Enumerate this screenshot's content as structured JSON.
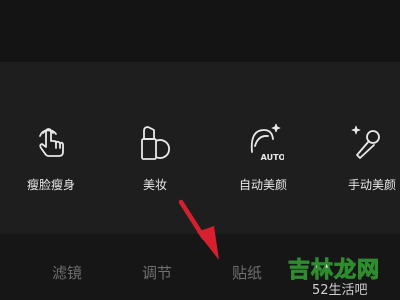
{
  "colors": {
    "background": "#1c1c1c",
    "panel": "#1e1e1e",
    "tabs_bar": "#161616",
    "icon_stroke": "#e8e8e8",
    "tab_text": "#6e6e6e",
    "arrow": "#d6202e",
    "watermark_green": "#2e8b2e"
  },
  "tools": [
    {
      "label": "瘦脸瘦身",
      "icon": "tap-hand-icon"
    },
    {
      "label": "美妆",
      "icon": "lipstick-icon"
    },
    {
      "label": "自动美颜",
      "icon": "auto-beauty-icon"
    },
    {
      "label": "手动美颜",
      "icon": "wand-icon"
    }
  ],
  "tabs": [
    {
      "label": "滤镜"
    },
    {
      "label": "调节"
    },
    {
      "label": "贴纸"
    }
  ],
  "auto_badge": "AUTO",
  "watermark": {
    "main": "吉林龙网",
    "sub": "52生活吧"
  }
}
